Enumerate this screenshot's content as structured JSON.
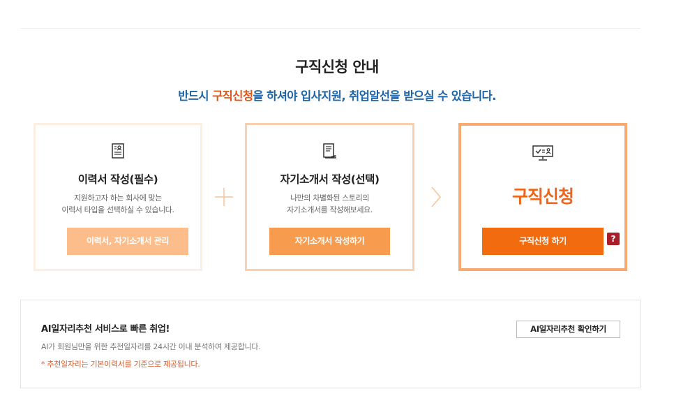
{
  "header": {
    "title": "구직신청 안내",
    "subtitle_pre": "반드시 ",
    "subtitle_highlight": "구직신청",
    "subtitle_post": "을 하셔야 입사지원, 취업알선을 받으실 수 있습니다."
  },
  "steps": [
    {
      "icon": "resume-document-icon",
      "title": "이력서 작성(필수)",
      "desc_line1": "지원하고자 하는 회사에 맞는",
      "desc_line2": "이력서 타입을 선택하실 수 있습니다.",
      "button": "이력서, 자기소개서 관리"
    },
    {
      "icon": "cover-letter-pen-icon",
      "title": "자기소개서 작성(선택)",
      "desc_line1": "나만의 차별화된 스토리의",
      "desc_line2": "자기소개서를 작성해보세요.",
      "button": "자기소개서 작성하기"
    },
    {
      "icon": "monitor-checklist-icon",
      "title": "구직신청",
      "button": "구직신청 하기",
      "help": "?"
    }
  ],
  "ai": {
    "title": "AI일자리추천 서비스로 빠른 취업!",
    "desc": "AI가 회원님만을 위한 추천일자리를 24시간 이내 분석하여 제공합니다.",
    "note": "* 추천일자리는 기본이력서를 기준으로 제공됩니다.",
    "button": "AI일자리추천 확인하기"
  },
  "colors": {
    "accent": "#f26c0f",
    "subtitle_blue": "#1e64a6",
    "highlight": "#e0561a"
  }
}
